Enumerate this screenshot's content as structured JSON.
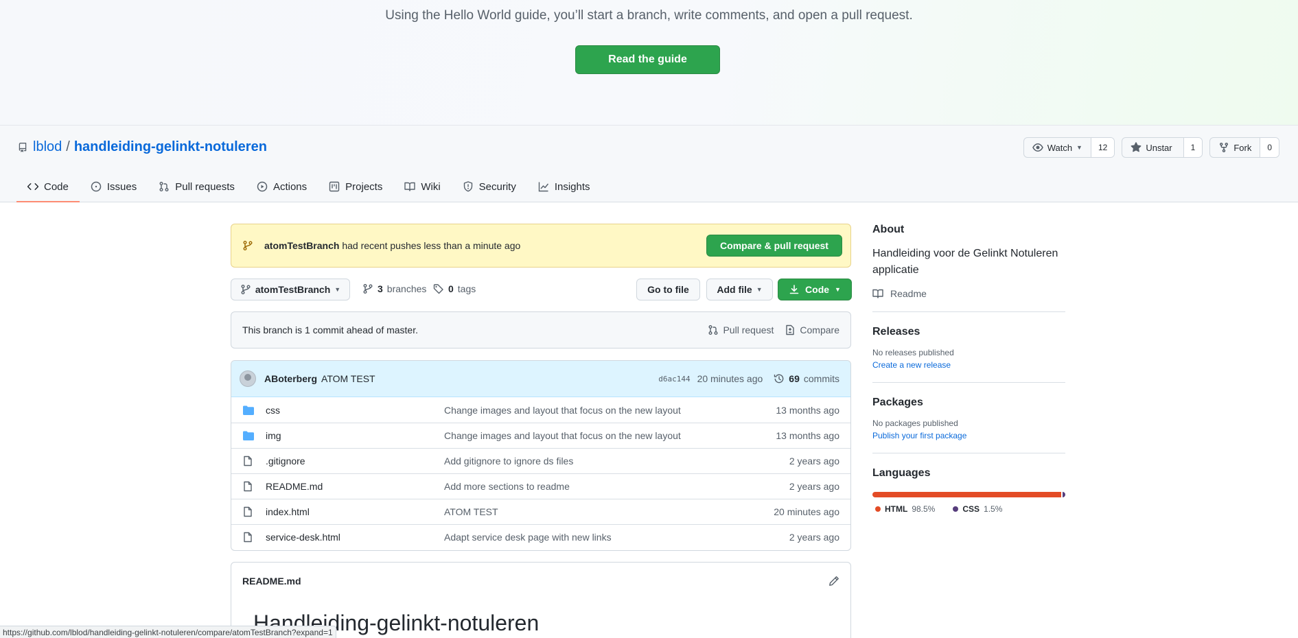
{
  "banner": {
    "text": "Using the Hello World guide, you’ll start a branch, write comments, and open a pull request.",
    "button": "Read the guide"
  },
  "repo": {
    "owner": "lblod",
    "separator": "/",
    "name": "handleiding-gelinkt-notuleren",
    "watch_label": "Watch",
    "watch_count": "12",
    "star_label": "Unstar",
    "star_count": "1",
    "fork_label": "Fork",
    "fork_count": "0"
  },
  "tabs": [
    {
      "label": "Code",
      "icon": "code-icon",
      "active": true
    },
    {
      "label": "Issues",
      "icon": "issue-icon"
    },
    {
      "label": "Pull requests",
      "icon": "pull-request-icon"
    },
    {
      "label": "Actions",
      "icon": "play-icon"
    },
    {
      "label": "Projects",
      "icon": "project-icon"
    },
    {
      "label": "Wiki",
      "icon": "book-icon"
    },
    {
      "label": "Security",
      "icon": "shield-icon"
    },
    {
      "label": "Insights",
      "icon": "graph-icon"
    }
  ],
  "flash": {
    "branch": "atomTestBranch",
    "text": "had recent pushes less than a minute ago",
    "button": "Compare & pull request"
  },
  "toolbar": {
    "branch": "atomTestBranch",
    "branches_count": "3",
    "branches_label": "branches",
    "tags_count": "0",
    "tags_label": "tags",
    "goto_file": "Go to file",
    "add_file": "Add file",
    "code": "Code"
  },
  "ahead": {
    "text": "This branch is 1 commit ahead of master.",
    "pull_request": "Pull request",
    "compare": "Compare"
  },
  "latest_commit": {
    "author": "ABoterberg",
    "message": "ATOM TEST",
    "sha": "d6ac144",
    "ago": "20 minutes ago",
    "commits_count": "69",
    "commits_label": "commits"
  },
  "files": [
    {
      "type": "folder",
      "name": "css",
      "message": "Change images and layout that focus on the new layout",
      "age": "13 months ago"
    },
    {
      "type": "folder",
      "name": "img",
      "message": "Change images and layout that focus on the new layout",
      "age": "13 months ago"
    },
    {
      "type": "file",
      "name": ".gitignore",
      "message": "Add gitignore to ignore ds files",
      "age": "2 years ago"
    },
    {
      "type": "file",
      "name": "README.md",
      "message": "Add more sections to readme",
      "age": "2 years ago"
    },
    {
      "type": "file",
      "name": "index.html",
      "message": "ATOM TEST",
      "age": "20 minutes ago"
    },
    {
      "type": "file",
      "name": "service-desk.html",
      "message": "Adapt service desk page with new links",
      "age": "2 years ago"
    }
  ],
  "readme": {
    "filename": "README.md",
    "heading": "Handleiding-gelinkt-notuleren"
  },
  "sidebar": {
    "about_title": "About",
    "about_desc": "Handleiding voor de Gelinkt Notuleren applicatie",
    "readme_link": "Readme",
    "releases_title": "Releases",
    "releases_none": "No releases published",
    "releases_create": "Create a new release",
    "packages_title": "Packages",
    "packages_none": "No packages published",
    "packages_publish": "Publish your first package",
    "languages_title": "Languages",
    "languages": [
      {
        "name": "HTML",
        "percent": "98.5%",
        "value": 98.5,
        "color": "#e34c26"
      },
      {
        "name": "CSS",
        "percent": "1.5%",
        "value": 1.5,
        "color": "#563d7c"
      }
    ]
  },
  "status_bar": {
    "url": "https://github.com/lblod/handleiding-gelinkt-notuleren/compare/atomTestBranch?expand=1"
  },
  "colors": {
    "primary_green": "#2da44e",
    "link_blue": "#0969da",
    "active_tab_underline": "#fd8c73",
    "flash_yellow": "#fff8c5",
    "commit_bar_blue": "#ddf4ff",
    "folder_blue": "#54aeff"
  }
}
